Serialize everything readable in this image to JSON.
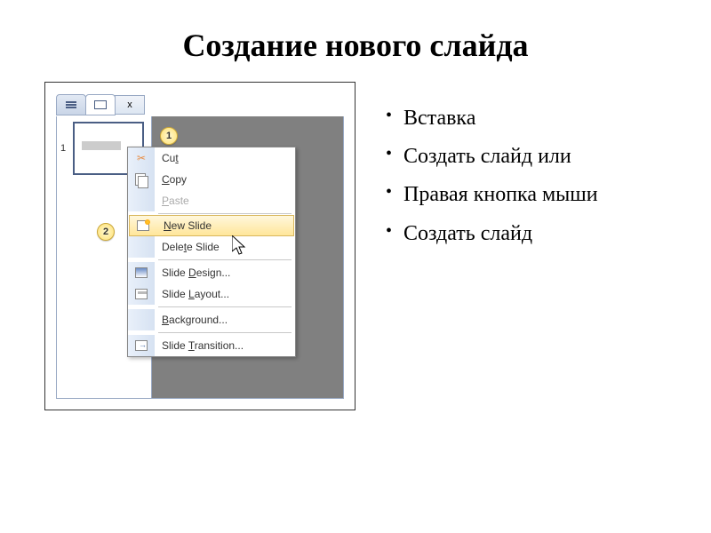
{
  "title": "Создание нового слайда",
  "bullets": [
    "Вставка",
    "Создать слайд или",
    "Правая кнопка мыши",
    "Создать слайд"
  ],
  "tabs": {
    "close": "x"
  },
  "thumb_number": "1",
  "callouts": {
    "one": "1",
    "two": "2"
  },
  "menu": {
    "cut": "Cut",
    "copy": "Copy",
    "paste": "Paste",
    "new_slide": "New Slide",
    "delete_slide_prefix": "Dele",
    "delete_slide_u": "t",
    "delete_slide_suffix": "e Slide",
    "slide_design": "Slide Design...",
    "slide_layout": "Slide Layout...",
    "background": "Background...",
    "slide_transition": "Slide Transition..."
  }
}
